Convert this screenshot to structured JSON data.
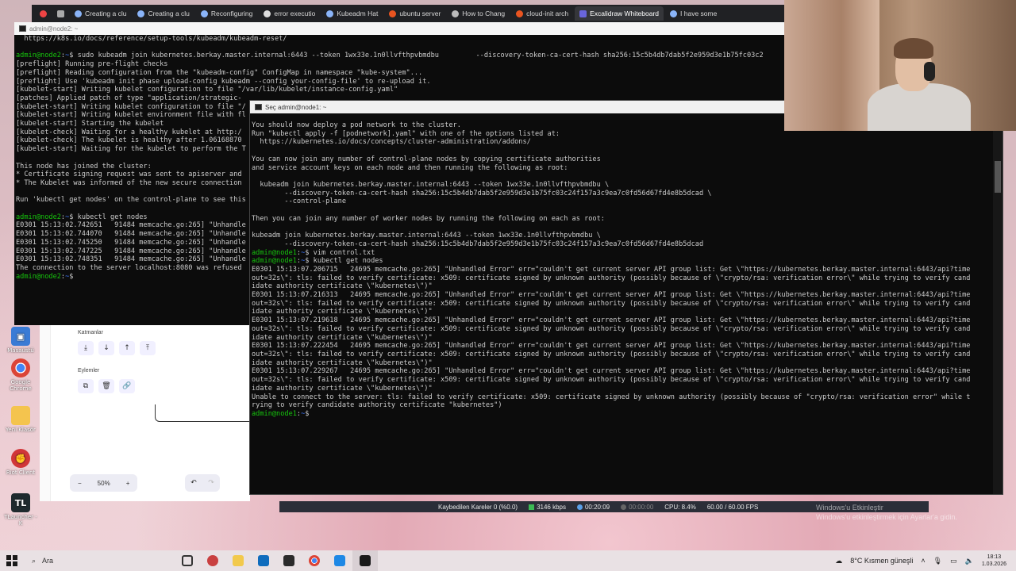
{
  "browser": {
    "tabs": [
      {
        "label": "",
        "active": false
      },
      {
        "label": "",
        "active": false
      },
      {
        "label": "Creating a clu",
        "active": false
      },
      {
        "label": "Creating a clu",
        "active": false
      },
      {
        "label": "Reconfiguring",
        "active": false
      },
      {
        "label": "error executio",
        "active": false
      },
      {
        "label": "Kubeadm Hat",
        "active": false
      },
      {
        "label": "ubuntu server",
        "active": false
      },
      {
        "label": "How to Chang",
        "active": false
      },
      {
        "label": "cloud-init arch",
        "active": false
      },
      {
        "label": "Excalidraw Whiteboard",
        "active": true
      },
      {
        "label": "I have some",
        "active": false
      }
    ]
  },
  "desktop": {
    "icons": [
      {
        "label": "Masaüstü"
      },
      {
        "label": "Google Chrome"
      },
      {
        "label": "Yeni Klasör"
      },
      {
        "label": "Riot Client"
      },
      {
        "label": "TLauncher - K"
      }
    ]
  },
  "terminal_node2": {
    "title": "admin@node2: ~",
    "lines": [
      "  https://k8s.io/docs/reference/setup-tools/kubeadm/kubeadm-reset/",
      "",
      "admin@node2:~$ sudo kubeadm join kubernetes.berkay.master.internal:6443 --token 1wx33e.1n0llvfthpvbmdbu         --discovery-token-ca-cert-hash sha256:15c5b4db7dab5f2e959d3e1b75fc03c2",
      "[preflight] Running pre-flight checks",
      "[preflight] Reading configuration from the \"kubeadm-config\" ConfigMap in namespace \"kube-system\"...",
      "[preflight] Use 'kubeadm init phase upload-config kubeadm --config your-config-file' to re-upload it.",
      "[kubelet-start] Writing kubelet configuration to file \"/var/lib/kubelet/instance-config.yaml\"",
      "[patches] Applied patch of type \"application/strategic-",
      "[kubelet-start] Writing kubelet configuration to file \"/",
      "[kubelet-start] Writing kubelet environment file with fl",
      "[kubelet-start] Starting the kubelet",
      "[kubelet-check] Waiting for a healthy kubelet at http:/",
      "[kubelet-check] The kubelet is healthy after 1.06168870",
      "[kubelet-start] Waiting for the kubelet to perform the T",
      "",
      "This node has joined the cluster:",
      "* Certificate signing request was sent to apiserver and",
      "* The Kubelet was informed of the new secure connection",
      "",
      "Run 'kubectl get nodes' on the control-plane to see this",
      "",
      "admin@node2:~$ kubectl get nodes",
      "E0301 15:13:02.742651   91484 memcache.go:265] \"Unhandle",
      "E0301 15:13:02.744070   91484 memcache.go:265] \"Unhandle",
      "E0301 15:13:02.745250   91484 memcache.go:265] \"Unhandle",
      "E0301 15:13:02.747225   91484 memcache.go:265] \"Unhandle",
      "E0301 15:13:02.748351   91484 memcache.go:265] \"Unhandle",
      "The connection to the server localhost:8080 was refused",
      "admin@node2:~$"
    ]
  },
  "terminal_node1": {
    "title": "Seç admin@node1: ~",
    "lines": [
      "You should now deploy a pod network to the cluster.",
      "Run \"kubectl apply -f [podnetwork].yaml\" with one of the options listed at:",
      "  https://kubernetes.io/docs/concepts/cluster-administration/addons/",
      "",
      "You can now join any number of control-plane nodes by copying certificate authorities",
      "and service account keys on each node and then running the following as root:",
      "",
      "  kubeadm join kubernetes.berkay.master.internal:6443 --token 1wx33e.1n0llvfthpvbmdbu \\",
      "        --discovery-token-ca-cert-hash sha256:15c5b4db7dab5f2e959d3e1b75fc03c24f157a3c9ea7c0fd56d67fd4e8b5dcad \\",
      "        --control-plane",
      "",
      "Then you can join any number of worker nodes by running the following on each as root:",
      "",
      "kubeadm join kubernetes.berkay.master.internal:6443 --token 1wx33e.1n0llvfthpvbmdbu \\",
      "        --discovery-token-ca-cert-hash sha256:15c5b4db7dab5f2e959d3e1b75fc03c24f157a3c9ea7c0fd56d67fd4e8b5dcad",
      "admin@node1:~$ vim control.txt",
      "admin@node1:~$ kubectl get nodes",
      "E0301 15:13:07.206715   24695 memcache.go:265] \"Unhandled Error\" err=\"couldn't get current server API group list: Get \\\"https://kubernetes.berkay.master.internal:6443/api?time",
      "out=32s\\\": tls: failed to verify certificate: x509: certificate signed by unknown authority (possibly because of \\\"crypto/rsa: verification error\\\" while trying to verify cand",
      "idate authority certificate \\\"kubernetes\\\")\"",
      "E0301 15:13:07.216313   24695 memcache.go:265] \"Unhandled Error\" err=\"couldn't get current server API group list: Get \\\"https://kubernetes.berkay.master.internal:6443/api?time",
      "out=32s\\\": tls: failed to verify certificate: x509: certificate signed by unknown authority (possibly because of \\\"crypto/rsa: verification error\\\" while trying to verify cand",
      "idate authority certificate \\\"kubernetes\\\")\"",
      "E0301 15:13:07.219618   24695 memcache.go:265] \"Unhandled Error\" err=\"couldn't get current server API group list: Get \\\"https://kubernetes.berkay.master.internal:6443/api?time",
      "out=32s\\\": tls: failed to verify certificate: x509: certificate signed by unknown authority (possibly because of \\\"crypto/rsa: verification error\\\" while trying to verify cand",
      "idate authority certificate \\\"kubernetes\\\")\"",
      "E0301 15:13:07.222454   24695 memcache.go:265] \"Unhandled Error\" err=\"couldn't get current server API group list: Get \\\"https://kubernetes.berkay.master.internal:6443/api?time",
      "out=32s\\\": tls: failed to verify certificate: x509: certificate signed by unknown authority (possibly because of \\\"crypto/rsa: verification error\\\" while trying to verify cand",
      "idate authority certificate \\\"kubernetes\\\")\"",
      "E0301 15:13:07.229267   24695 memcache.go:265] \"Unhandled Error\" err=\"couldn't get current server API group list: Get \\\"https://kubernetes.berkay.master.internal:6443/api?time",
      "out=32s\\\": tls: failed to verify certificate: x509: certificate signed by unknown authority (possibly because of \\\"crypto/rsa: verification error\\\" while trying to verify cand",
      "idate authority certificate \\\"kubernetes\\\")\"",
      "Unable to connect to the server: tls: failed to verify certificate: x509: certificate signed by unknown authority (possibly because of \"crypto/rsa: verification error\" while t",
      "rying to verify candidate authority certificate \"kubernetes\")",
      "admin@node1:~$ "
    ]
  },
  "excalidraw": {
    "layers_label": "Katmanlar",
    "actions_label": "Eylemler",
    "zoom": "50%",
    "zoom_out": "−",
    "zoom_in": "+"
  },
  "obs": {
    "dropped_frames": "Kaybedilen Kareler 0 (%0.0)",
    "bitrate": "3146 kbps",
    "stream_time": "00:20:09",
    "rec_time": "00:00:00",
    "cpu": "CPU: 8.4%",
    "fps": "60.00 / 60.00 FPS"
  },
  "watermark": {
    "line1": "Windows'u Etkinleştir",
    "line2": "Windows'u etkinleştirmek için Ayarlar'a gidin."
  },
  "taskbar": {
    "search_placeholder": "Ara",
    "weather": "8°C  Kısmen güneşli",
    "time": "18:13",
    "date": "1.03.2026"
  },
  "colors": {
    "prompt_user": "#16c60c",
    "prompt_path": "#3b78ff",
    "terminal_bg": "#0c0c0c",
    "terminal_fg": "#cccccc"
  }
}
